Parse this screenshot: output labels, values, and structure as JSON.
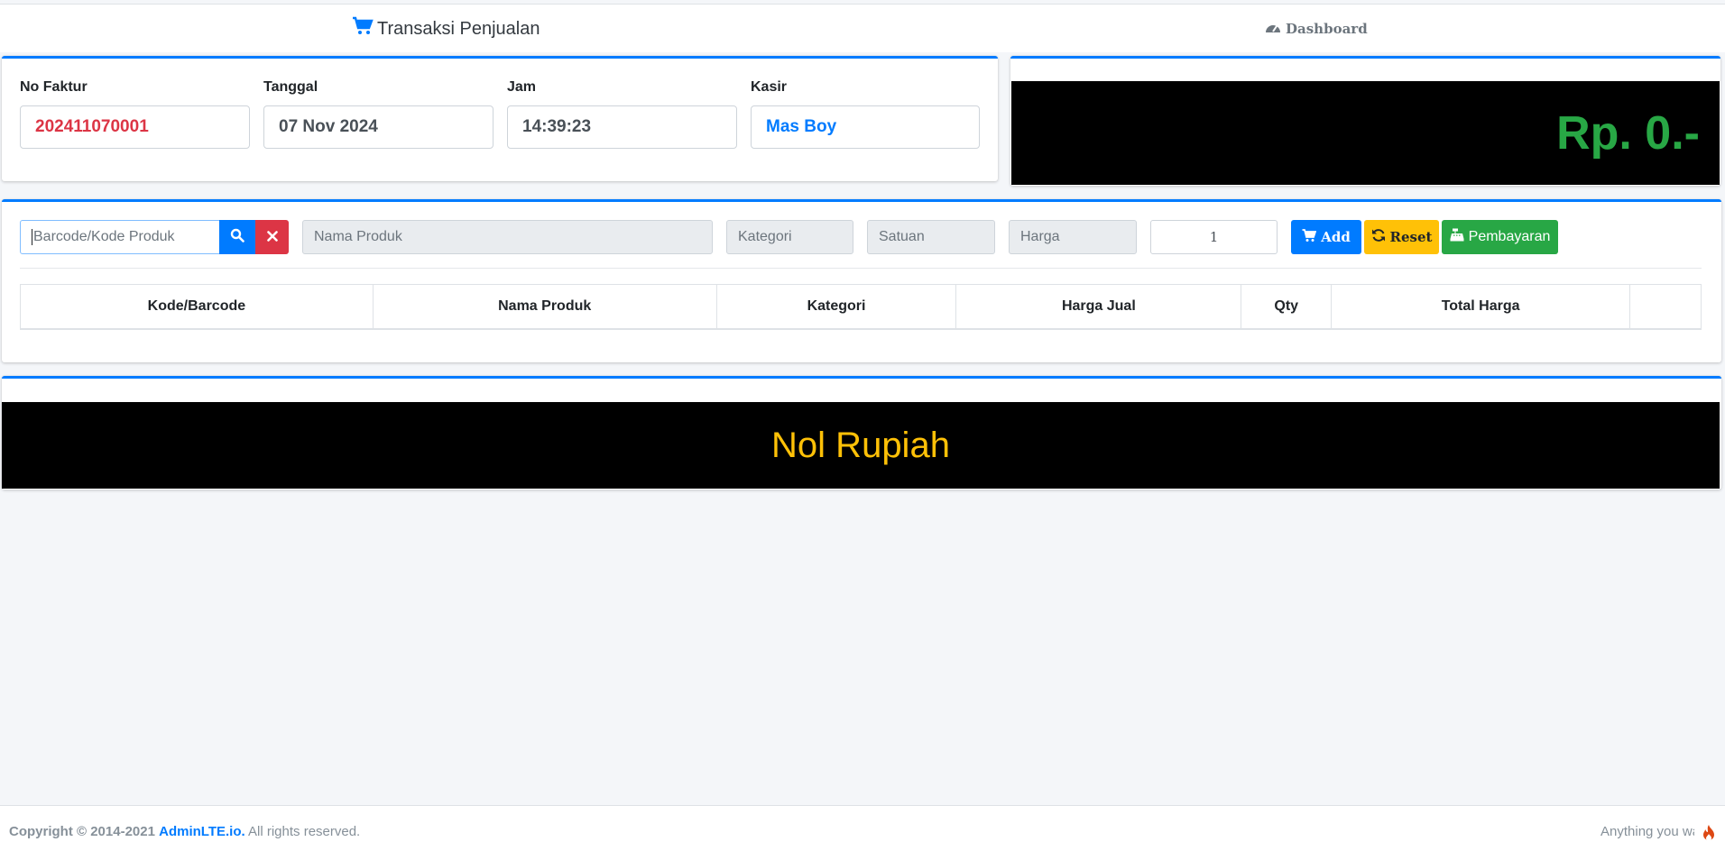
{
  "nav": {
    "transaksi_label": "Transaksi Penjualan",
    "dashboard_label": "Dashboard"
  },
  "header_fields": {
    "no_faktur_label": "No Faktur",
    "no_faktur_value": "202411070001",
    "tanggal_label": "Tanggal",
    "tanggal_value": "07 Nov 2024",
    "jam_label": "Jam",
    "jam_value": "14:39:23",
    "kasir_label": "Kasir",
    "kasir_value": "Mas Boy"
  },
  "total_display": "Rp. 0.-",
  "entry": {
    "barcode_placeholder": "Barcode/Kode Produk",
    "nama_placeholder": "Nama Produk",
    "kategori_placeholder": "Kategori",
    "satuan_placeholder": "Satuan",
    "harga_placeholder": "Harga",
    "qty_value": "1",
    "add_label": "Add",
    "reset_label": "Reset",
    "pembayaran_label": "Pembayaran"
  },
  "table": {
    "headers": [
      "Kode/Barcode",
      "Nama Produk",
      "Kategori",
      "Harga Jual",
      "Qty",
      "Total Harga",
      ""
    ]
  },
  "terbilang": "Nol Rupiah",
  "footer": {
    "copyright": "Copyright © 2014-2021",
    "brand": "AdminLTE.io.",
    "rights": "All rights reserved.",
    "right_text": "Anything you wa"
  },
  "colors": {
    "primary": "#007bff",
    "danger": "#dc3545",
    "warning": "#ffc107",
    "success": "#28a745"
  },
  "icons": [
    "cart-icon",
    "dashboard-gauge-icon",
    "search-icon",
    "close-icon",
    "cart-plus-icon",
    "sync-icon",
    "cash-register-icon",
    "flame-icon"
  ]
}
